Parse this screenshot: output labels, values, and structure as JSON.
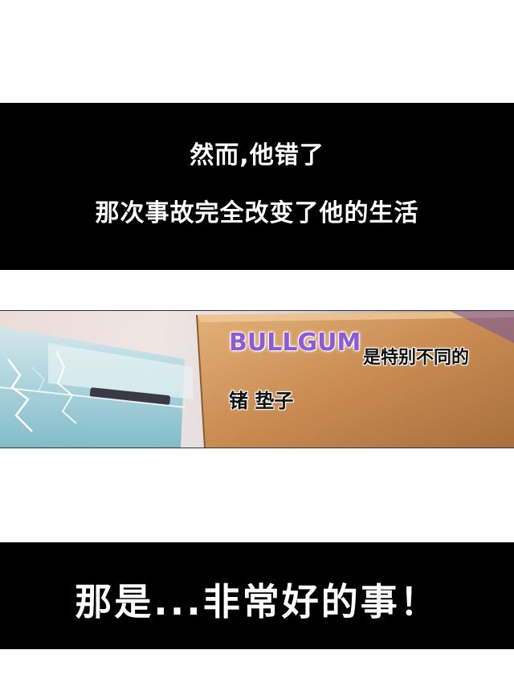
{
  "top_caption": {
    "line1": "然而,他错了",
    "line2": "那次事故完全改变了他的生活"
  },
  "sign": {
    "brand": "BULLGUM",
    "text1": "是特别不同的",
    "text2": "锗 垫子"
  },
  "bottom_caption": {
    "text": "那是...非常好的事！"
  },
  "colors": {
    "panel": "#000000",
    "caption": "#ffffff",
    "brand": "#8b5cd6",
    "board": "#c68a52"
  }
}
